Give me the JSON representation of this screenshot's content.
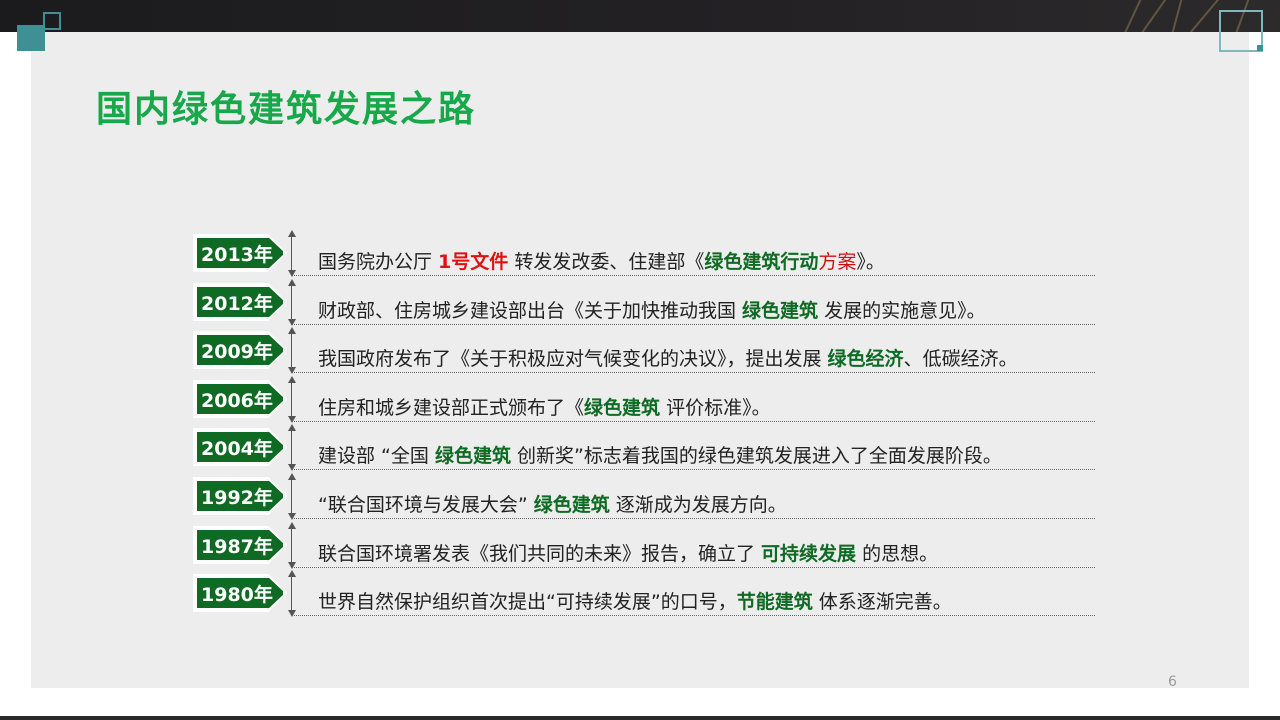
{
  "title": "国内绿色建筑发展之路",
  "page_number": "6",
  "colors": {
    "accent_green": "#17a84a",
    "badge_green": "#0f6a23",
    "highlight_red": "#e01010",
    "teal": "#3f8f95"
  },
  "timeline": [
    {
      "year": "2013年",
      "parts": [
        {
          "t": "国务院办公厅 ",
          "s": ""
        },
        {
          "t": "1号文件",
          "s": "r"
        },
        {
          "t": " 转发发改委、住建部《",
          "s": ""
        },
        {
          "t": "绿色建筑行动",
          "s": "g"
        },
        {
          "t": "方案",
          "s": "r2"
        },
        {
          "t": "》。",
          "s": ""
        }
      ]
    },
    {
      "year": "2012年",
      "parts": [
        {
          "t": "财政部、住房城乡建设部出台《关于加快推动我国 ",
          "s": ""
        },
        {
          "t": "绿色建筑",
          "s": "g"
        },
        {
          "t": " 发展的实施意见》。",
          "s": ""
        }
      ]
    },
    {
      "year": "2009年",
      "parts": [
        {
          "t": "我国政府发布了《关于积极应对气候变化的决议》，提出发展 ",
          "s": ""
        },
        {
          "t": "绿色经济",
          "s": "g"
        },
        {
          "t": "、低碳经济。",
          "s": ""
        }
      ]
    },
    {
      "year": "2006年",
      "parts": [
        {
          "t": "住房和城乡建设部正式颁布了《",
          "s": ""
        },
        {
          "t": "绿色建筑",
          "s": "g"
        },
        {
          "t": " 评价标准》。",
          "s": ""
        }
      ]
    },
    {
      "year": "2004年",
      "parts": [
        {
          "t": "建设部 “全国 ",
          "s": ""
        },
        {
          "t": "绿色建筑",
          "s": "g"
        },
        {
          "t": " 创新奖”标志着我国的绿色建筑发展进入了全面发展阶段。",
          "s": ""
        }
      ]
    },
    {
      "year": "1992年",
      "parts": [
        {
          "t": " “联合国环境与发展大会” ",
          "s": ""
        },
        {
          "t": "绿色建筑",
          "s": "g"
        },
        {
          "t": " 逐渐成为发展方向。",
          "s": ""
        }
      ]
    },
    {
      "year": "1987年",
      "parts": [
        {
          "t": "联合国环境署发表《我们共同的未来》报告，确立了 ",
          "s": ""
        },
        {
          "t": "可持续发展",
          "s": "g"
        },
        {
          "t": " 的思想。",
          "s": ""
        }
      ]
    },
    {
      "year": "1980年",
      "parts": [
        {
          "t": "世界自然保护组织首次提出“可持续发展”的口号，",
          "s": ""
        },
        {
          "t": "节能建筑",
          "s": "g"
        },
        {
          "t": " 体系逐渐完善。",
          "s": ""
        }
      ]
    }
  ]
}
